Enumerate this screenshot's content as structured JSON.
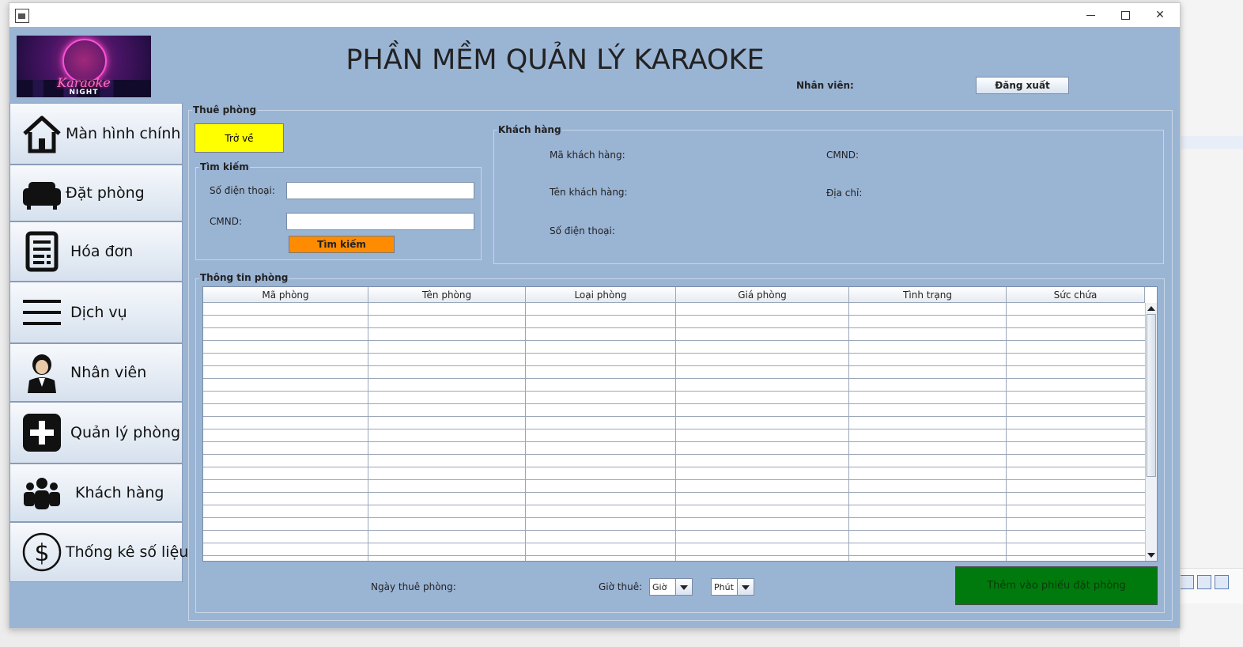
{
  "window": {
    "title": ""
  },
  "header": {
    "app_title": "PHẦN MỀM QUẢN LÝ KARAOKE",
    "logo_text": "Karaoke",
    "logo_subtext": "NIGHT",
    "staff_label": "Nhân viên:",
    "logout_label": "Đăng xuất"
  },
  "sidebar": {
    "items": [
      {
        "label": "Màn hình chính",
        "icon": "home-icon"
      },
      {
        "label": "Đặt phòng",
        "icon": "sofa-icon"
      },
      {
        "label": "Hóa đơn",
        "icon": "invoice-icon"
      },
      {
        "label": "Dịch vụ",
        "icon": "menu-icon"
      },
      {
        "label": "Nhân viên",
        "icon": "employee-icon"
      },
      {
        "label": "Quản lý phòng",
        "icon": "plus-icon"
      },
      {
        "label": "Khách hàng",
        "icon": "customers-icon"
      },
      {
        "label": "Thống kê số liệu",
        "icon": "dollar-icon"
      }
    ]
  },
  "rent": {
    "title": "Thuê  phòng",
    "back_label": "Trở về",
    "search": {
      "title": "Tìm kiếm",
      "phone_label": "Số điện thoại:",
      "phone_value": "",
      "id_label": "CMND:",
      "id_value": "",
      "button_label": "Tìm kiếm"
    },
    "customer": {
      "title": "Khách hàng",
      "code_label": "Mã khách hàng:",
      "id_label": "CMND:",
      "name_label": "Tên khách hàng:",
      "address_label": "Địa chỉ:",
      "phone_label": "Số điện thoại:"
    },
    "rooms": {
      "title": "Thông tin phòng",
      "columns": [
        "Mã phòng",
        "Tên phòng",
        "Loại phòng",
        "Giá phòng",
        "Tình trạng",
        "Sức chứa"
      ],
      "rows": []
    },
    "bottom": {
      "date_label": "Ngày thuê phòng:",
      "time_label": "Giờ thuê:",
      "hour_value": "Giờ",
      "minute_value": "Phút",
      "add_label": "Thêm vào phiếu đặt phòng"
    }
  },
  "colors": {
    "background": "#9ab4d4",
    "back_button": "#ffff00",
    "search_button": "#ff8c00",
    "add_button": "#007a0c"
  }
}
